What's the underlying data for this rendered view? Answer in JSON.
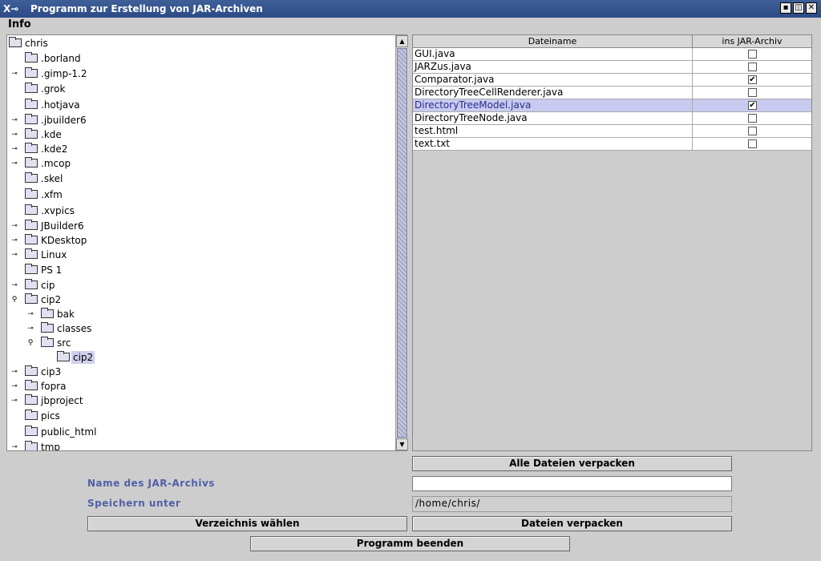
{
  "window": {
    "title": "Programm zur Erstellung von JAR-Archiven",
    "app_icon": "X-window-icon"
  },
  "menubar": {
    "info": "Info"
  },
  "tree": {
    "items": [
      {
        "label": "chris"
      },
      {
        "label": ".borland"
      },
      {
        "label": ".gimp-1.2"
      },
      {
        "label": ".grok"
      },
      {
        "label": ".hotjava"
      },
      {
        "label": ".jbuilder6"
      },
      {
        "label": ".kde"
      },
      {
        "label": ".kde2"
      },
      {
        "label": ".mcop"
      },
      {
        "label": ".skel"
      },
      {
        "label": ".xfm"
      },
      {
        "label": ".xvpics"
      },
      {
        "label": "JBuilder6"
      },
      {
        "label": "KDesktop"
      },
      {
        "label": "Linux"
      },
      {
        "label": "PS 1"
      },
      {
        "label": "cip"
      },
      {
        "label": "cip2"
      },
      {
        "label": "bak"
      },
      {
        "label": "classes"
      },
      {
        "label": "src"
      },
      {
        "label": "cip2"
      },
      {
        "label": "cip3"
      },
      {
        "label": "fopra"
      },
      {
        "label": "jbproject"
      },
      {
        "label": "pics"
      },
      {
        "label": "public_html"
      },
      {
        "label": "tmp"
      }
    ]
  },
  "table": {
    "headers": [
      "Dateiname",
      "ins JAR-Archiv"
    ],
    "rows": [
      {
        "name": "GUI.java",
        "checked": false
      },
      {
        "name": "JARZus.java",
        "checked": false
      },
      {
        "name": "Comparator.java",
        "checked": true
      },
      {
        "name": "DirectoryTreeCellRenderer.java",
        "checked": false
      },
      {
        "name": "DirectoryTreeModel.java",
        "checked": true
      },
      {
        "name": "DirectoryTreeNode.java",
        "checked": false
      },
      {
        "name": "test.html",
        "checked": false
      },
      {
        "name": "text.txt",
        "checked": false
      }
    ]
  },
  "controls": {
    "all_files": "Alle Dateien verpacken",
    "jar_name_label": "Name des JAR-Archivs",
    "jar_name_value": "",
    "save_under_label": "Speichern unter",
    "save_path": "/home/chris/",
    "choose_dir": "Verzeichnis wählen",
    "pack_files": "Dateien verpacken",
    "quit": "Programm beenden"
  }
}
